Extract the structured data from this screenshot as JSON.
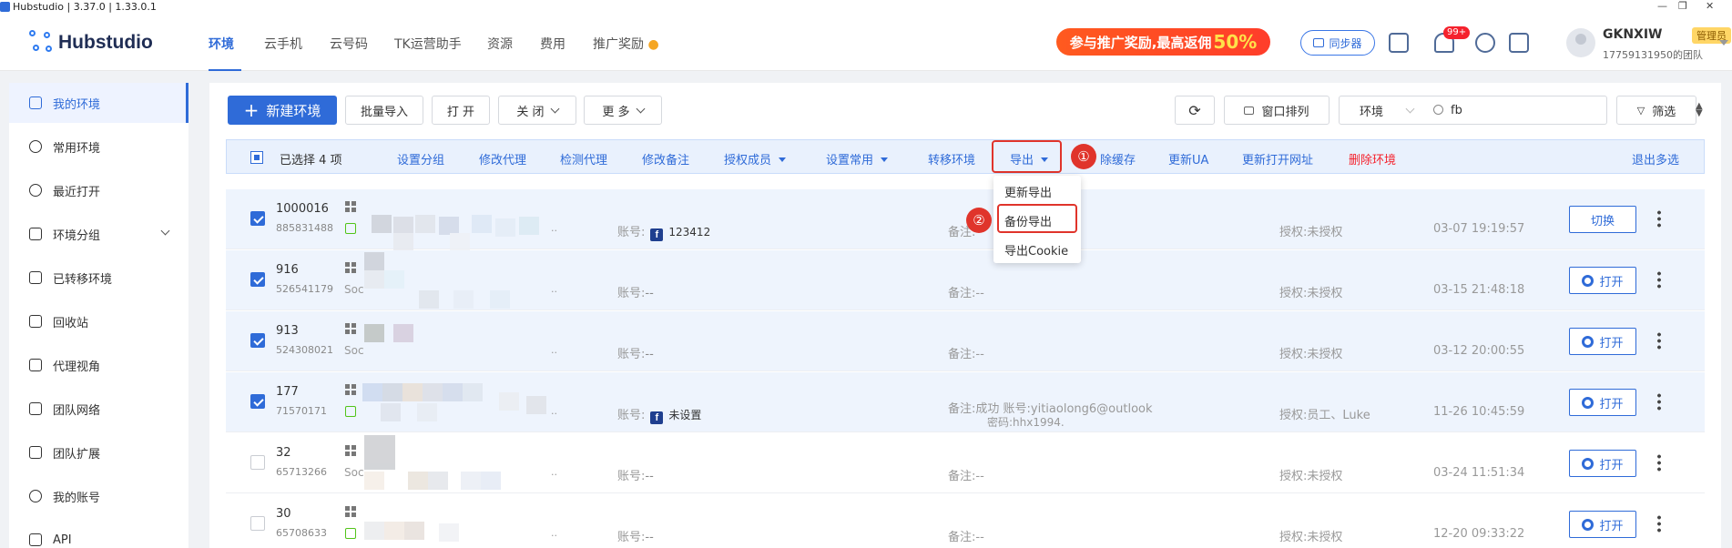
{
  "window": {
    "title": "Hubstudio | 3.37.0 | 1.33.0.1"
  },
  "header": {
    "logo_text": "Hubstudio",
    "nav": [
      {
        "label": "环境",
        "active": true
      },
      {
        "label": "云手机"
      },
      {
        "label": "云号码"
      },
      {
        "label": "TK运营助手"
      },
      {
        "label": "资源"
      },
      {
        "label": "费用"
      },
      {
        "label": "推广奖励"
      }
    ],
    "promo": {
      "text": "参与推广奖励,最高返佣",
      "highlight": "50%"
    },
    "sync_label": "同步器",
    "notification_badge": "99+",
    "user": {
      "name": "GKNXIW",
      "role": "管理员",
      "team": "17759131950的团队"
    }
  },
  "sidebar": {
    "items": [
      {
        "label": "我的环境",
        "icon": "monitor-icon",
        "active": true
      },
      {
        "label": "常用环境",
        "icon": "star-icon"
      },
      {
        "label": "最近打开",
        "icon": "clock-icon"
      },
      {
        "label": "环境分组",
        "icon": "layers-icon",
        "expandable": true
      },
      {
        "label": "已转移环境",
        "icon": "transfer-icon"
      },
      {
        "label": "回收站",
        "icon": "trash-icon"
      },
      {
        "label": "代理视角",
        "icon": "proxy-icon"
      },
      {
        "label": "团队网络",
        "icon": "network-icon"
      },
      {
        "label": "团队扩展",
        "icon": "extension-icon"
      },
      {
        "label": "我的账号",
        "icon": "user-icon"
      },
      {
        "label": "API",
        "icon": "api-icon"
      }
    ]
  },
  "toolbar": {
    "new_env": "新建环境",
    "batch_import": "批量导入",
    "open": "打 开",
    "close": "关 闭",
    "more": "更 多",
    "arrange": "窗口排列",
    "filter_select": "环境",
    "search_value": "fb",
    "filter": "筛选"
  },
  "selection": {
    "text_prefix": "已选择",
    "count": "4",
    "text_suffix": "项",
    "actions": [
      {
        "label": "设置分组"
      },
      {
        "label": "修改代理"
      },
      {
        "label": "检测代理"
      },
      {
        "label": "修改备注"
      },
      {
        "label": "授权成员",
        "dropdown": true
      },
      {
        "label": "设置常用",
        "dropdown": true
      },
      {
        "label": "转移环境"
      },
      {
        "label": "导出",
        "dropdown": true
      },
      {
        "label": "除缓存"
      },
      {
        "label": "更新UA"
      },
      {
        "label": "更新打开网址"
      },
      {
        "label": "删除环境",
        "danger": true
      }
    ],
    "exit_multi": "退出多选",
    "step1": "①",
    "step2": "②"
  },
  "export_menu": [
    "更新导出",
    "备份导出",
    "导出Cookie"
  ],
  "rows": [
    {
      "id": "1000016",
      "sub": "885831488",
      "selected": true,
      "soc": "",
      "account_label": "账号:",
      "account": "123412",
      "fb": true,
      "note_label": "备注:",
      "note": "",
      "note2": "",
      "auth": "授权:未授权",
      "time": "03-07 19:19:57",
      "action": "切换"
    },
    {
      "id": "916",
      "sub": "526541179",
      "selected": true,
      "soc": "Soc",
      "account_label": "账号:",
      "account": "--",
      "fb": false,
      "note_label": "备注:",
      "note": "--",
      "note2": "",
      "auth": "授权:未授权",
      "time": "03-15 21:48:18",
      "action": "打开"
    },
    {
      "id": "913",
      "sub": "524308021",
      "selected": true,
      "soc": "Soc",
      "account_label": "账号:",
      "account": "--",
      "fb": false,
      "note_label": "备注:",
      "note": "--",
      "note2": "",
      "auth": "授权:未授权",
      "time": "03-12 20:00:55",
      "action": "打开"
    },
    {
      "id": "177",
      "sub": "71570171",
      "selected": true,
      "soc": "",
      "account_label": "账号:",
      "account": "未设置",
      "fb": true,
      "note_label": "备注:",
      "note": "成功 账号:yitiaolong6@outlook",
      "note2": "密码:hhx1994.",
      "auth": "授权:员工、Luke",
      "time": "11-26 10:45:59",
      "action": "打开"
    },
    {
      "id": "32",
      "sub": "65713266",
      "selected": false,
      "soc": "Soc",
      "account_label": "账号:",
      "account": "--",
      "fb": false,
      "note_label": "备注:",
      "note": "--",
      "note2": "",
      "auth": "授权:未授权",
      "time": "03-24 11:51:34",
      "action": "打开"
    },
    {
      "id": "30",
      "sub": "65708633",
      "selected": false,
      "soc": "",
      "account_label": "账号:",
      "account": "--",
      "fb": false,
      "note_label": "备注:",
      "note": "--",
      "note2": "",
      "auth": "授权:未授权",
      "time": "12-20 09:33:22",
      "action": "打开"
    }
  ],
  "colors": {
    "primary": "#2f6bd8",
    "danger": "#e0342b",
    "selected_row": "#eef4fd"
  }
}
